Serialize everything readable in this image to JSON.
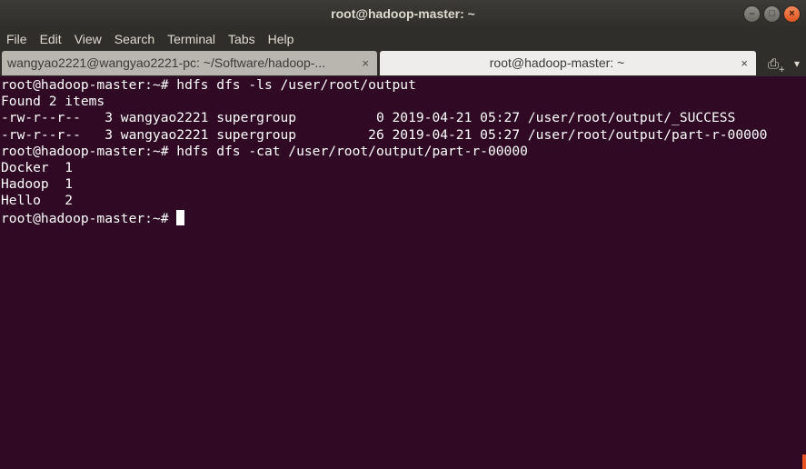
{
  "window": {
    "title": "root@hadoop-master: ~",
    "minimize_icon": "minimize-icon",
    "maximize_icon": "maximize-icon",
    "close_icon": "close-icon",
    "minimize_glyph": "–",
    "maximize_glyph": "□",
    "close_glyph": "×"
  },
  "menubar": {
    "items": [
      {
        "label": "File"
      },
      {
        "label": "Edit"
      },
      {
        "label": "View"
      },
      {
        "label": "Search"
      },
      {
        "label": "Terminal"
      },
      {
        "label": "Tabs"
      },
      {
        "label": "Help"
      }
    ]
  },
  "tabs": [
    {
      "label": "wangyao2221@wangyao2221-pc: ~/Software/hadoop-...",
      "active": false,
      "close_glyph": "×"
    },
    {
      "label": "root@hadoop-master: ~",
      "active": true,
      "close_glyph": "×"
    }
  ],
  "tabbar": {
    "new_tab_icon": "new-tab-icon",
    "new_tab_glyph": "⎙",
    "tab_menu_icon": "chevron-down-icon",
    "tab_menu_glyph": "▾"
  },
  "terminal": {
    "lines": [
      "root@hadoop-master:~# hdfs dfs -ls /user/root/output",
      "Found 2 items",
      "-rw-r--r--   3 wangyao2221 supergroup          0 2019-04-21 05:27 /user/root/output/_SUCCESS",
      "-rw-r--r--   3 wangyao2221 supergroup         26 2019-04-21 05:27 /user/root/output/part-r-00000",
      "root@hadoop-master:~# hdfs dfs -cat /user/root/output/part-r-00000",
      "Docker  1",
      "Hadoop  1",
      "Hello   2"
    ],
    "prompt": "root@hadoop-master:~# "
  },
  "colors": {
    "terminal_bg": "#300a24",
    "terminal_fg": "#ffffff",
    "titlebar_bg": "#2f2e2a",
    "accent": "#e95420"
  }
}
